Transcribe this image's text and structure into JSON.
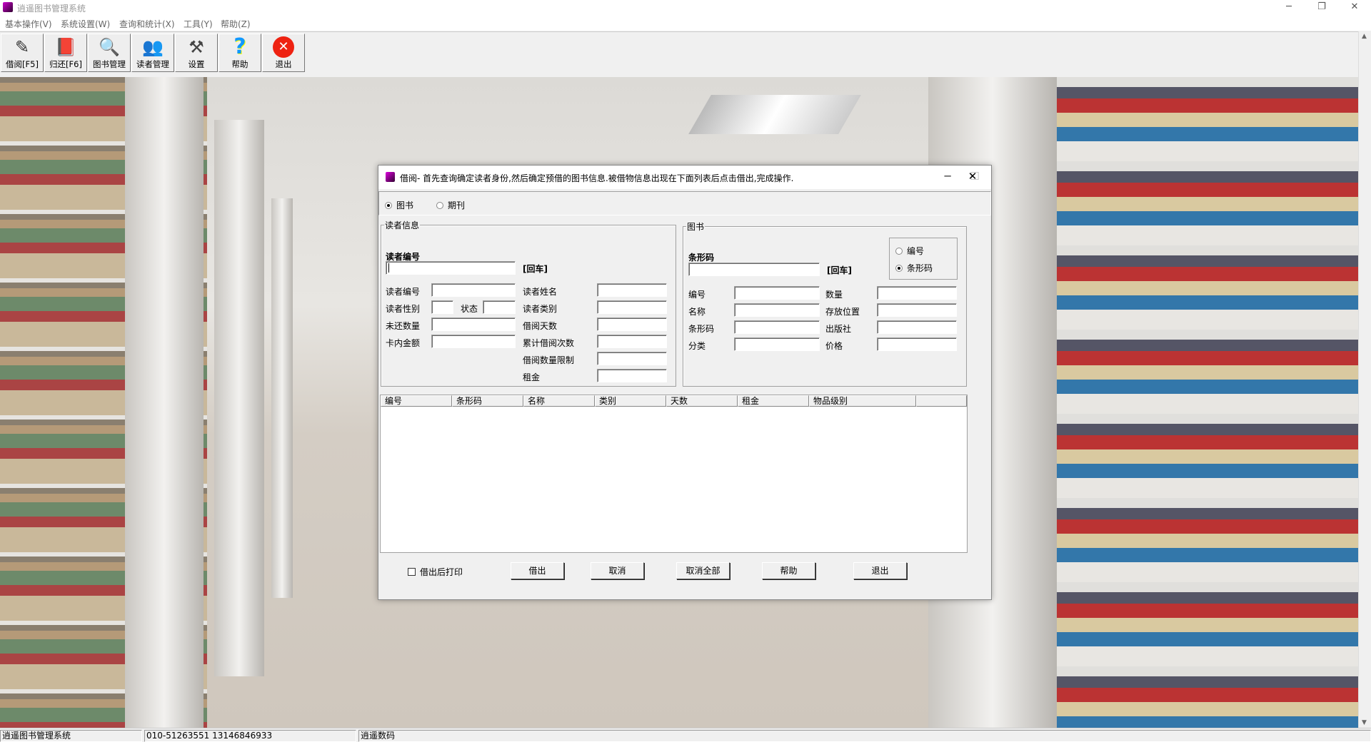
{
  "app": {
    "title": "逍遥图书管理系统",
    "icon": "books-icon"
  },
  "menu": [
    "基本操作(V)",
    "系统设置(W)",
    "查询和统计(X)",
    "工具(Y)",
    "帮助(Z)"
  ],
  "toolbar": [
    {
      "label": "借阅[F5]",
      "icon": "borrow-book-icon",
      "glyph": "✎"
    },
    {
      "label": "归还[F6]",
      "icon": "return-book-icon",
      "glyph": "📕"
    },
    {
      "label": "图书管理",
      "icon": "book-management-icon",
      "glyph": "🔍"
    },
    {
      "label": "读者管理",
      "icon": "reader-management-icon",
      "glyph": "👥"
    },
    {
      "label": "设置",
      "icon": "settings-tools-icon",
      "glyph": "⚒"
    },
    {
      "label": "帮助",
      "icon": "help-icon",
      "glyph": "?"
    },
    {
      "label": "退出",
      "icon": "exit-icon",
      "glyph": "✕"
    }
  ],
  "status": [
    "逍遥图书管理系统",
    "010-51263551  13146846933",
    "逍遥数码"
  ],
  "dialog": {
    "title": "借阅- 首先查询确定读者身份,然后确定预借的图书信息.被借物信息出现在下面列表后点击借出,完成操作.",
    "type_radios": [
      {
        "label": "图书",
        "checked": true
      },
      {
        "label": "期刊",
        "checked": false
      }
    ],
    "reader": {
      "group": "读者信息",
      "id_label": "读者编号",
      "id_value": "",
      "enter": "[回车]",
      "left_fields": [
        "读者编号",
        "读者性别",
        "未还数量",
        "卡内金额"
      ],
      "status_label": "状态",
      "right_fields": [
        "读者姓名",
        "读者类别",
        "借阅天数",
        "累计借阅次数",
        "借阅数量限制",
        "租金"
      ]
    },
    "book": {
      "group": "图书",
      "code_label": "条形码",
      "code_value": "",
      "enter": "[回车]",
      "mode_radios": [
        {
          "label": "编号",
          "checked": false
        },
        {
          "label": "条形码",
          "checked": true
        }
      ],
      "left_fields": [
        "编号",
        "名称",
        "条形码",
        "分类"
      ],
      "right_fields": [
        "数量",
        "存放位置",
        "出版社",
        "价格"
      ]
    },
    "list_columns": [
      "编号",
      "条形码",
      "名称",
      "类别",
      "天数",
      "租金",
      "物品级别"
    ],
    "print_after": {
      "label": "借出后打印",
      "checked": false
    },
    "buttons": [
      "借出",
      "取消",
      "取消全部",
      "帮助",
      "退出"
    ]
  }
}
